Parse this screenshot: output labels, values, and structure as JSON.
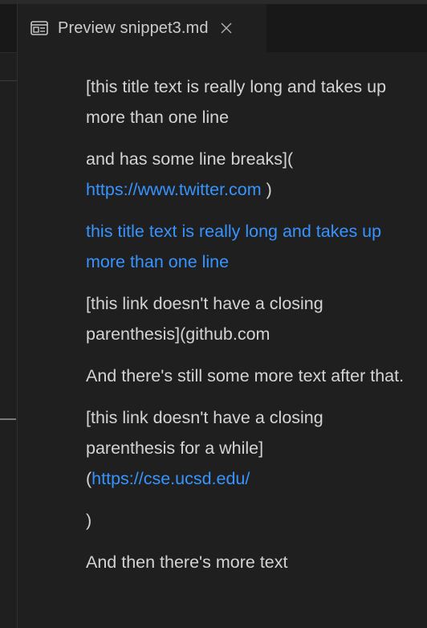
{
  "colors": {
    "background": "#1f1f1f",
    "tabbar": "#181818",
    "text": "#d4d4d4",
    "link": "#3794ff"
  },
  "tab": {
    "icon": "preview-icon",
    "label": "Preview snippet3.md",
    "close_icon": "close-icon"
  },
  "markdown": {
    "p1": "[this title text is really long and takes up more than one line",
    "p2_text": "and has some line breaks](",
    "p2_link": "https://www.twitter.com",
    "p2_tail": " )",
    "p3_link": "this title text is really long and takes up more than one line",
    "p4": "[this link doesn't have a closing parenthesis](github.com",
    "p5": "And there's still some more text after that.",
    "p6_text": "[this link doesn't have a closing parenthesis for a while]",
    "p6_paren": "(",
    "p6_link": "https://cse.ucsd.edu/",
    "p7": ")",
    "p8": "And then there's more text"
  }
}
